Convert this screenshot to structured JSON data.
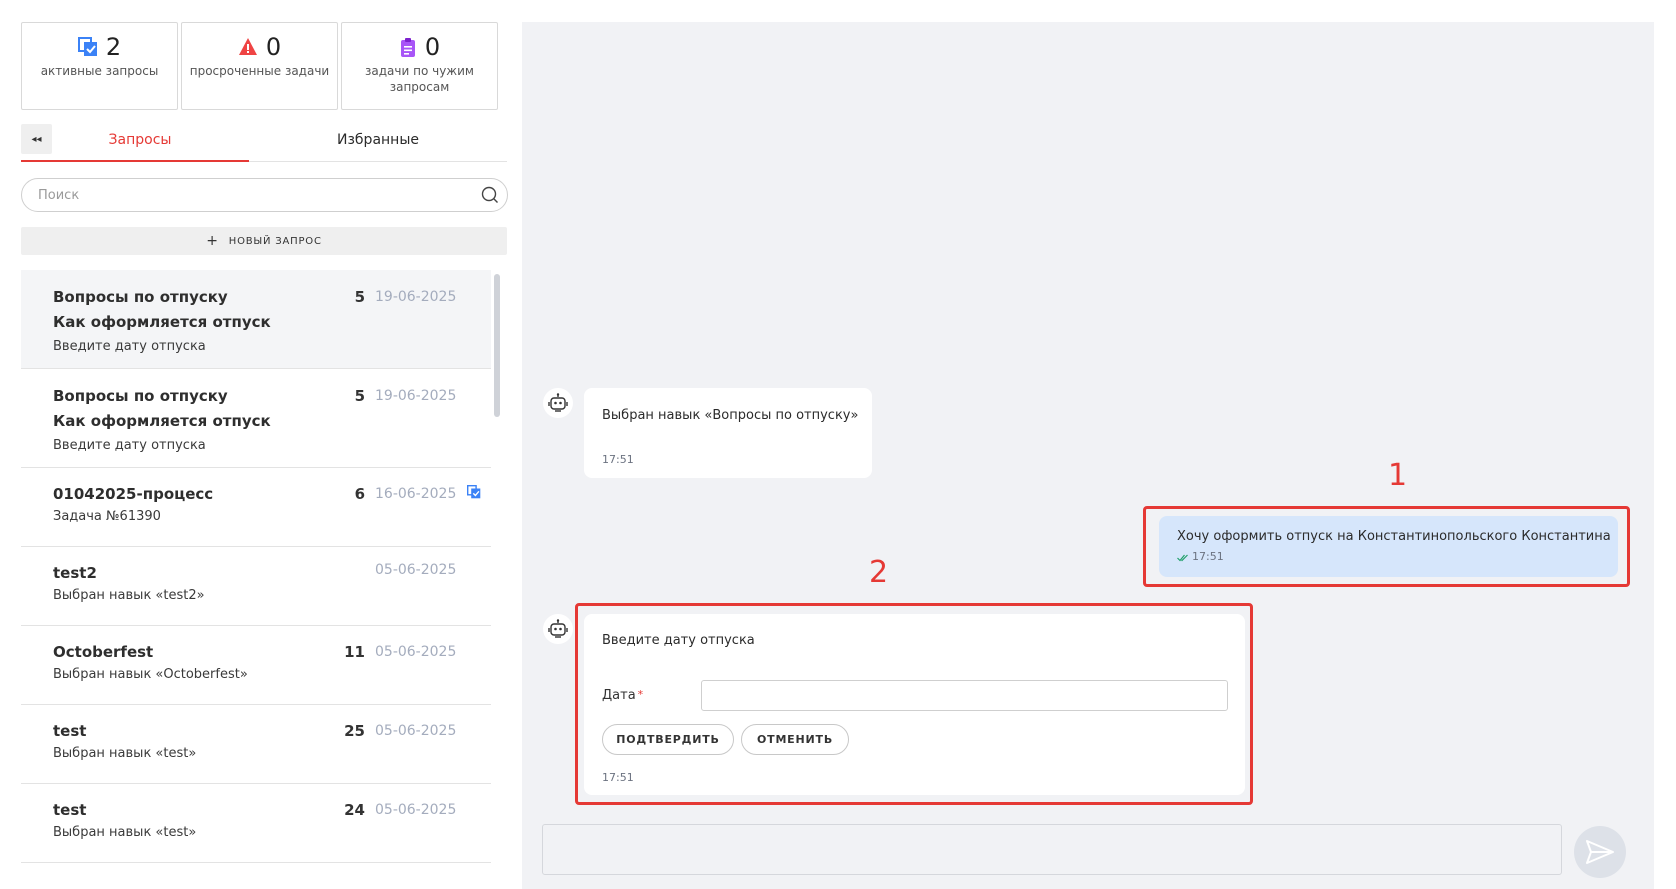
{
  "stats": [
    {
      "value": "2",
      "label": "активные запросы",
      "icon": "requests-icon"
    },
    {
      "value": "0",
      "label": "просроченные задачи",
      "icon": "warning-icon"
    },
    {
      "value": "0",
      "label": "задачи по чужим запросам",
      "icon": "clipboard-icon"
    }
  ],
  "tabs": {
    "collapse": "◂◂",
    "requests": "Запросы",
    "favorites": "Избранные"
  },
  "search": {
    "placeholder": "Поиск"
  },
  "new_request": {
    "plus": "+",
    "label": "НОВЫЙ ЗАПРОС"
  },
  "list": [
    {
      "title": "Вопросы по отпуску",
      "title2": "Как оформляется отпуск",
      "sub": "Введите дату отпуска",
      "count": "5",
      "date": "19-06-2025",
      "selected": true
    },
    {
      "title": "Вопросы по отпуску",
      "title2": "Как оформляется отпуск",
      "sub": "Введите дату отпуска",
      "count": "5",
      "date": "19-06-2025"
    },
    {
      "title": "01042025-процесс",
      "sub": "Задача №61390",
      "count": "6",
      "date": "16-06-2025",
      "icon": "task-icon"
    },
    {
      "title": "test2",
      "sub": "Выбран навык «test2»",
      "count": "",
      "date": "05-06-2025"
    },
    {
      "title": "Octoberfest",
      "sub": "Выбран навык «Octoberfest»",
      "count": "11",
      "date": "05-06-2025"
    },
    {
      "title": "test",
      "sub": "Выбран навык «test»",
      "count": "25",
      "date": "05-06-2025"
    },
    {
      "title": "test",
      "sub": "Выбран навык «test»",
      "count": "24",
      "date": "05-06-2025"
    }
  ],
  "chat": {
    "bot_msg_1": {
      "text": "Выбран навык «Вопросы по отпуску»",
      "time": "17:51"
    },
    "user_msg": {
      "text": "Хочу оформить отпуск на Константинопольского Константина",
      "time": "17:51",
      "status_icon": "double-check-icon"
    },
    "bot_msg_2": {
      "text": "Введите дату отпуска",
      "field_label": "Дата",
      "required_mark": "*",
      "confirm": "ПОДТВЕРДИТЬ",
      "cancel": "ОТМЕНИТЬ",
      "time": "17:51"
    },
    "annotations": [
      "1",
      "2"
    ]
  },
  "colors": {
    "accent": "#e53935",
    "user_bubble": "#d6e6fb",
    "chat_bg": "#f1f2f5",
    "date_text": "#a4acbd"
  }
}
